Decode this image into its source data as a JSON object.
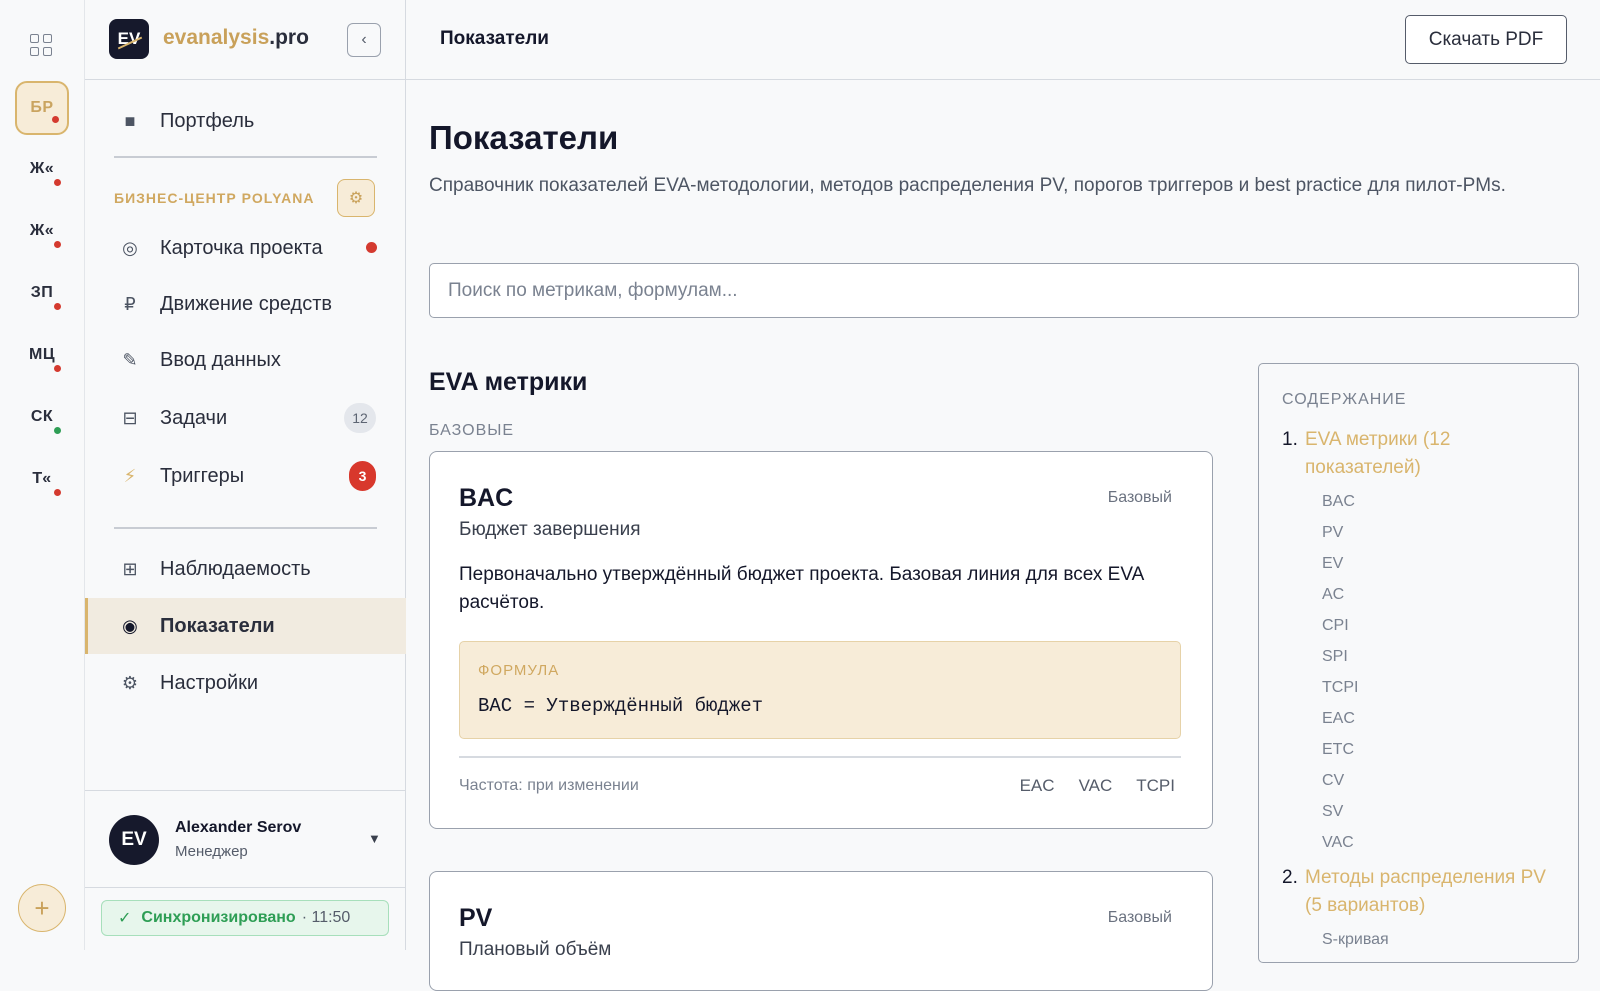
{
  "rail": {
    "projects": [
      {
        "abbr": "БР",
        "status": "red",
        "active": true
      },
      {
        "abbr": "Ж«",
        "status": "red"
      },
      {
        "abbr": "Ж«",
        "status": "red"
      },
      {
        "abbr": "ЗП",
        "status": "red"
      },
      {
        "abbr": "МЦ",
        "status": "red"
      },
      {
        "abbr": "СК",
        "status": "green"
      },
      {
        "abbr": "Т«",
        "status": "red"
      }
    ],
    "add_label": "+"
  },
  "sidebar": {
    "logo_text": "EV",
    "brand": "evanalysis",
    "brand_suffix": ".pro",
    "collapse_icon": "‹",
    "portfolio_label": "Портфель",
    "section_title": "БИЗНЕС-ЦЕНТР POLYANA",
    "items": [
      {
        "label": "Карточка проекта",
        "icon": "◎"
      },
      {
        "label": "Движение средств",
        "icon": "₽"
      },
      {
        "label": "Ввод данных",
        "icon": "✎"
      },
      {
        "label": "Задачи",
        "icon": "⊟",
        "badge": "12"
      },
      {
        "label": "Триггеры",
        "icon": "⚡",
        "badge": "3"
      }
    ],
    "bottom_items": [
      {
        "label": "Наблюдаемость",
        "icon": "⊞"
      },
      {
        "label": "Показатели",
        "icon": "◉"
      },
      {
        "label": "Настройки",
        "icon": "⚙"
      }
    ],
    "user": {
      "initials": "EV",
      "name": "Alexander Serov",
      "role": "Менеджер"
    },
    "sync": {
      "status": "Синхронизировано",
      "time": "· 11:50"
    }
  },
  "topbar": {
    "title": "Показатели",
    "pdf_button": "Скачать PDF"
  },
  "main": {
    "title": "Показатели",
    "lead": "Справочник показателей EVA-методологии, методов распределения PV, порогов триггеров и best practice для пилот-PMs.",
    "search_placeholder": "Поиск по метрикам, формулам...",
    "section_title": "EVA метрики",
    "subsection": "БАЗОВЫЕ",
    "cards": [
      {
        "code": "BAC",
        "kind": "Базовый",
        "name": "Бюджет завершения",
        "description": "Первоначально утверждённый бюджет проекта. Базовая линия для всех EVA расчётов.",
        "formula_label": "ФОРМУЛА",
        "formula": "BAC = Утверждённый бюджет",
        "frequency": "Частота: при изменении",
        "related": [
          "EAC",
          "VAC",
          "TCPI"
        ]
      },
      {
        "code": "PV",
        "kind": "Базовый",
        "name": "Плановый объём"
      }
    ]
  },
  "toc": {
    "title": "СОДЕРЖАНИЕ",
    "sections": [
      {
        "num": "1.",
        "title": "EVA метрики (12 показателей)",
        "items": [
          "BAC",
          "PV",
          "EV",
          "AC",
          "CPI",
          "SPI",
          "TCPI",
          "EAC",
          "ETC",
          "CV",
          "SV",
          "VAC"
        ]
      },
      {
        "num": "2.",
        "title": "Методы распределения PV (5 вариантов)",
        "items": [
          "S-кривая"
        ]
      }
    ]
  },
  "colors": {
    "accent": "#d9b56d",
    "accent_bg": "#f7ecd8",
    "danger": "#d43a2f",
    "success": "#2e9e55",
    "ink": "#14172a"
  }
}
